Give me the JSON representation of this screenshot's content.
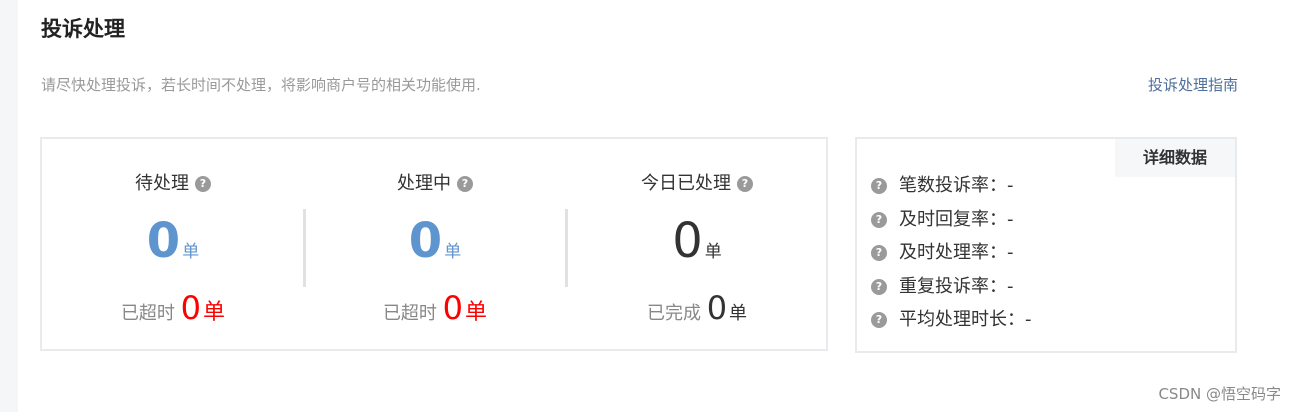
{
  "page": {
    "title": "投诉处理",
    "notice": "请尽快处理投诉，若长时间不处理，将影响商户号的相关功能使用.",
    "guide_link": "投诉处理指南"
  },
  "stats": {
    "pending": {
      "label": "待处理",
      "value": "0",
      "unit": "单",
      "sub_label": "已超时",
      "sub_value": "0",
      "sub_unit": "单"
    },
    "processing": {
      "label": "处理中",
      "value": "0",
      "unit": "单",
      "sub_label": "已超时",
      "sub_value": "0",
      "sub_unit": "单"
    },
    "today_done": {
      "label": "今日已处理",
      "value": "0",
      "unit": "单",
      "sub_label": "已完成",
      "sub_value": "0",
      "sub_unit": "单"
    }
  },
  "detail": {
    "tab_label": "详细数据",
    "metrics": [
      {
        "label": "笔数投诉率：",
        "value": "-"
      },
      {
        "label": "及时回复率：",
        "value": "-"
      },
      {
        "label": "及时处理率：",
        "value": "-"
      },
      {
        "label": "重复投诉率：",
        "value": "-"
      },
      {
        "label": "平均处理时长：",
        "value": "-"
      }
    ]
  },
  "help_glyph": "?",
  "colors": {
    "accent_blue": "#5f95cf",
    "alert_red": "#ff0000",
    "link": "#4d6f9c"
  },
  "watermark": "CSDN @悟空码字"
}
